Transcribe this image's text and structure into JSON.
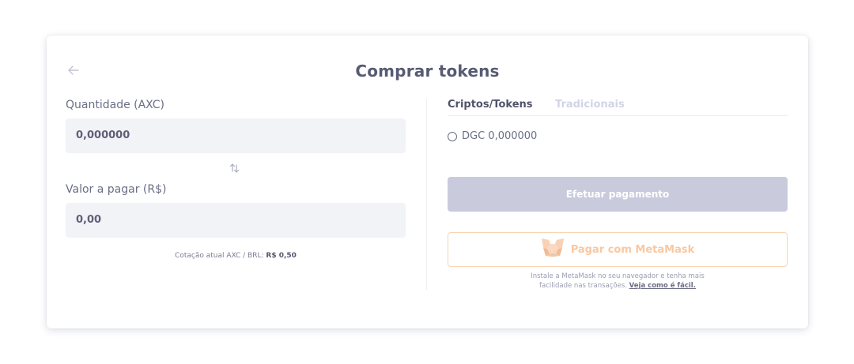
{
  "title": "Comprar tokens",
  "icons": {
    "back": "arrow-left-icon",
    "swap": "swap-arrows-icon",
    "metamask": "metamask-fox-icon"
  },
  "left": {
    "quantity_label": "Quantidade (AXC)",
    "quantity_value": "0,000000",
    "amount_label": "Valor a pagar (R$)",
    "amount_value": "0,00",
    "quote_prefix": "Cotação atual AXC / BRL:",
    "quote_value": "R$ 0,50"
  },
  "right": {
    "tabs": [
      {
        "label": "Criptos/Tokens",
        "active": true
      },
      {
        "label": "Tradicionais",
        "active": false
      }
    ],
    "options": [
      {
        "label": "DGC 0,000000",
        "selected": false
      }
    ],
    "pay_button": "Efetuar pagamento",
    "metamask_button": "Pagar com MetaMask",
    "metamask_help": "Instale a MetaMask no seu navegador e tenha mais",
    "metamask_help_2": "facilidade nas transações.",
    "metamask_link": "Veja como é fácil."
  },
  "colors": {
    "pay_button_disabled": "#c9cbdd",
    "metamask_accent": "#fac7a0",
    "input_bg": "#f2f3f7"
  }
}
